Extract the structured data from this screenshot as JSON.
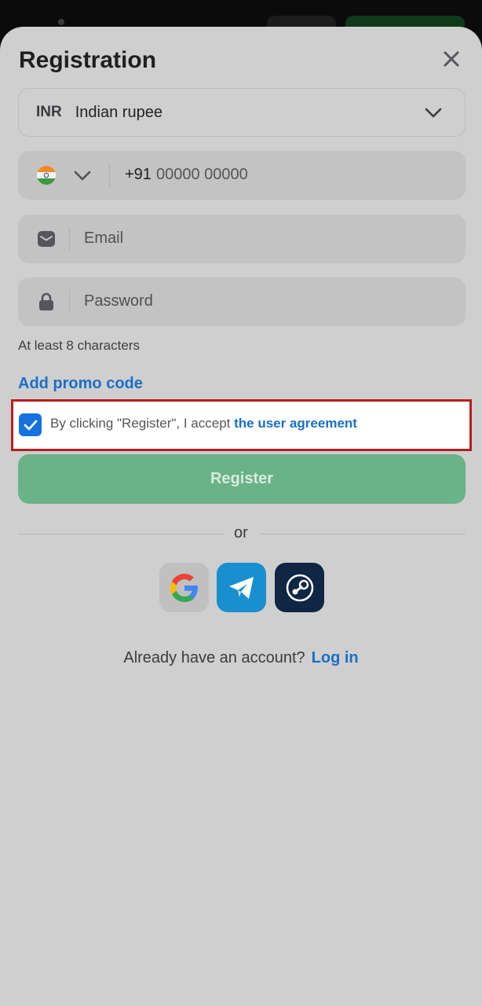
{
  "title": "Registration",
  "icons": {
    "close": "close-icon",
    "chevron": "chevron-down-icon",
    "flag": "india-flag-icon",
    "email": "envelope-icon",
    "password": "lock-icon",
    "checkbox": "checkmark-icon",
    "google": "google-icon",
    "telegram": "telegram-icon",
    "steam": "steam-icon"
  },
  "currency": {
    "code": "INR",
    "name": "Indian rupee"
  },
  "phone": {
    "country_code": "+91",
    "placeholder": "00000 00000"
  },
  "email": {
    "placeholder": "Email"
  },
  "password": {
    "placeholder": "Password",
    "hint": "At least 8 characters"
  },
  "promo": {
    "label": "Add promo code"
  },
  "agreement": {
    "checked": true,
    "text": "By clicking \"Register\", I accept ",
    "link_label": "the user agreement"
  },
  "register": {
    "label": "Register"
  },
  "divider": {
    "label": "or"
  },
  "social": {
    "google": "Google",
    "telegram": "Telegram",
    "steam": "Steam"
  },
  "login": {
    "prompt": "Already have an account?",
    "link_label": "Log in"
  },
  "colors": {
    "accent_blue": "#1a6fc7",
    "checkbox_blue": "#1570e0",
    "register_green": "#6ab288",
    "highlight_red": "#b3201f"
  }
}
